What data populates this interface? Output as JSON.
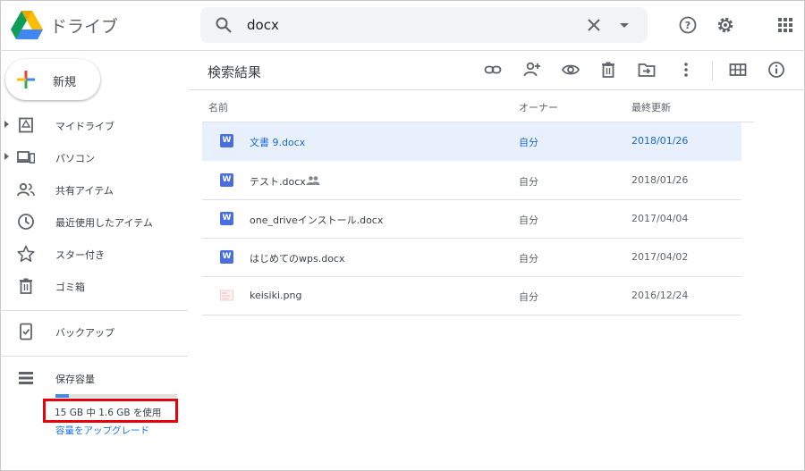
{
  "app": {
    "title": "ドライブ"
  },
  "search": {
    "value": "docx"
  },
  "sidebar": {
    "new_label": "新規",
    "items": [
      {
        "label": "マイドライブ",
        "icon": "my-drive-icon",
        "expandable": true
      },
      {
        "label": "パソコン",
        "icon": "computers-icon",
        "expandable": true
      },
      {
        "label": "共有アイテム",
        "icon": "shared-icon",
        "expandable": false
      },
      {
        "label": "最近使用したアイテム",
        "icon": "recent-icon",
        "expandable": false
      },
      {
        "label": "スター付き",
        "icon": "star-icon",
        "expandable": false
      },
      {
        "label": "ゴミ箱",
        "icon": "trash-icon",
        "expandable": false
      }
    ],
    "backup_label": "バックアップ",
    "storage": {
      "label": "保存容量",
      "usage": "15 GB 中 1.6 GB を使用",
      "used_fraction": 0.11,
      "upgrade": "容量をアップグレード"
    }
  },
  "main": {
    "title": "検索結果",
    "toolbar_icons": [
      "link-icon",
      "share-icon",
      "preview-icon",
      "delete-icon",
      "move-icon",
      "more-icon",
      "grid-view-icon",
      "info-icon"
    ],
    "columns": {
      "name": "名前",
      "owner": "オーナー",
      "modified": "最終更新"
    },
    "rows": [
      {
        "name": "文書 9.docx",
        "owner": "自分",
        "modified": "2018/01/26",
        "type": "word",
        "selected": true,
        "shared": false
      },
      {
        "name": "テスト.docx",
        "owner": "自分",
        "modified": "2018/01/26",
        "type": "word",
        "selected": false,
        "shared": true
      },
      {
        "name": "one_driveインストール.docx",
        "owner": "自分",
        "modified": "2017/04/04",
        "type": "word",
        "selected": false,
        "shared": false
      },
      {
        "name": "はじめてのwps.docx",
        "owner": "自分",
        "modified": "2017/04/02",
        "type": "word",
        "selected": false,
        "shared": false
      },
      {
        "name": "keisiki.png",
        "owner": "自分",
        "modified": "2016/12/24",
        "type": "image",
        "selected": false,
        "shared": false
      }
    ]
  },
  "colors": {
    "accent": "#1a73e8",
    "selected_row": "#e8f0fe",
    "highlight_box": "#e8000b",
    "word_icon": "#4a6ee0"
  }
}
